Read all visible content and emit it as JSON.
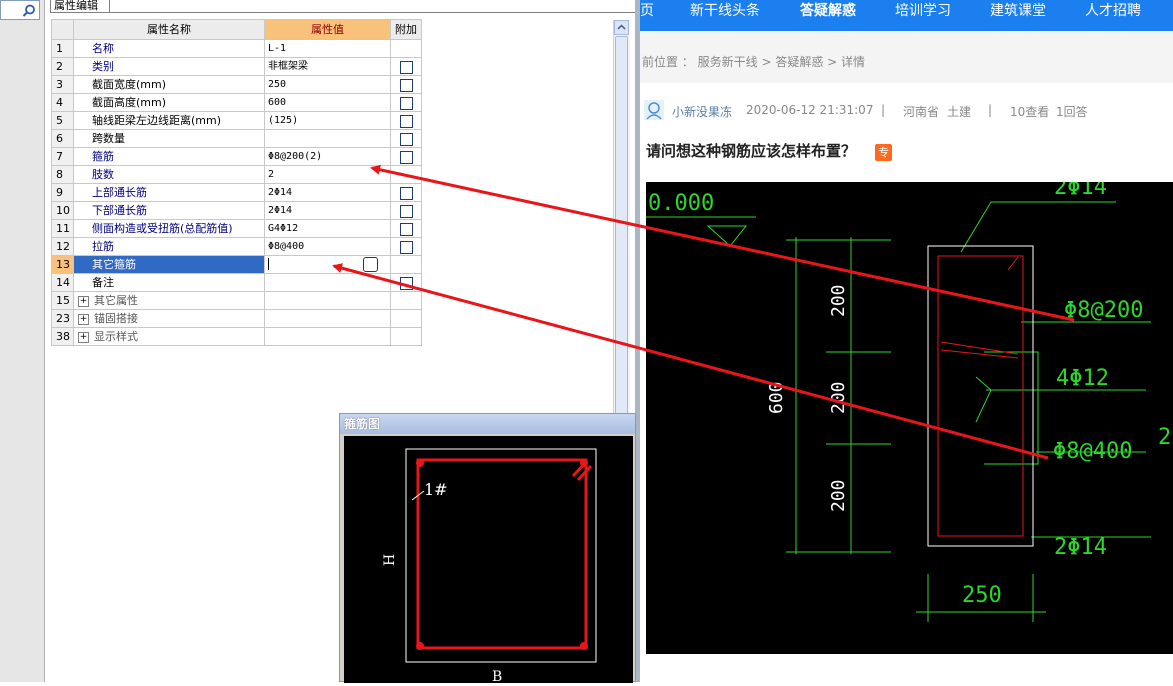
{
  "property_editor": {
    "tab_label": "属性编辑",
    "columns": {
      "number": "",
      "name": "属性名称",
      "value": "属性值",
      "extra": "附加"
    },
    "rows": [
      {
        "num": "1",
        "name": "名称",
        "value": "L-1",
        "check": false,
        "style": "blue"
      },
      {
        "num": "2",
        "name": "类别",
        "value": "非框架梁",
        "check": true,
        "style": "blue"
      },
      {
        "num": "3",
        "name": "截面宽度(mm)",
        "value": "250",
        "check": true,
        "style": "black"
      },
      {
        "num": "4",
        "name": "截面高度(mm)",
        "value": "600",
        "check": true,
        "style": "black"
      },
      {
        "num": "5",
        "name": "轴线距梁左边线距离(mm)",
        "value": "(125)",
        "check": true,
        "style": "black"
      },
      {
        "num": "6",
        "name": "跨数量",
        "value": "",
        "check": true,
        "style": "black"
      },
      {
        "num": "7",
        "name": "箍筋",
        "value": "Φ8@200(2)",
        "check": true,
        "style": "blue"
      },
      {
        "num": "8",
        "name": "肢数",
        "value": "2",
        "check": false,
        "style": "blue"
      },
      {
        "num": "9",
        "name": "上部通长筋",
        "value": "2Φ14",
        "check": true,
        "style": "blue"
      },
      {
        "num": "10",
        "name": "下部通长筋",
        "value": "2Φ14",
        "check": true,
        "style": "blue"
      },
      {
        "num": "11",
        "name": "侧面构造或受扭筋(总配筋值)",
        "value": "G4Φ12",
        "check": true,
        "style": "blue"
      },
      {
        "num": "12",
        "name": "拉筋",
        "value": "Φ8@400",
        "check": true,
        "style": "blue"
      },
      {
        "num": "13",
        "name": "其它箍筋",
        "value": "",
        "check": false,
        "style": "selected"
      },
      {
        "num": "14",
        "name": "备注",
        "value": "",
        "check": true,
        "style": "black"
      },
      {
        "num": "15",
        "name": "其它属性",
        "value": "",
        "check": false,
        "style": "group"
      },
      {
        "num": "23",
        "name": "锚固搭接",
        "value": "",
        "check": false,
        "style": "group"
      },
      {
        "num": "38",
        "name": "显示样式",
        "value": "",
        "check": false,
        "style": "group"
      }
    ]
  },
  "stirrup_dialog": {
    "title": "箍筋图",
    "label_bar": "1#",
    "label_h": "H",
    "label_b": "B"
  },
  "web": {
    "nav": [
      "页",
      "新干线头条",
      "答疑解惑",
      "培训学习",
      "建筑课堂",
      "人才招聘"
    ],
    "nav_active": "答疑解惑",
    "breadcrumb": "前位置 ： 服务新干线 > 答疑解惑 > 详情",
    "meta": {
      "user": "小新没果冻",
      "datetime": "2020-06-12 21:31:07",
      "sep": "|",
      "location": "河南省",
      "category": "土建",
      "views": "10查看",
      "answers": "1回答"
    },
    "question_title": "请问想这种钢筋应该怎样布置？",
    "expert_badge": "专",
    "drawing": {
      "elev_label": "0.000",
      "top_bar": "2Φ14",
      "stirrup": "Φ8@200",
      "side_bars": "4Φ12",
      "tie_bar": "Φ8@400",
      "bottom_bar": "2Φ14",
      "height": "600",
      "seg_top": "200",
      "seg_mid": "200",
      "seg_bot": "200",
      "width": "250",
      "cut_label": "2"
    }
  },
  "colors": {
    "nav_blue": "#1b7ff0",
    "header_value_bg": "#f9c27a",
    "selection_blue": "#316ac5",
    "arrow_red": "#e8161b",
    "cad_green": "#2ed52e",
    "cad_red": "#e8161b"
  }
}
